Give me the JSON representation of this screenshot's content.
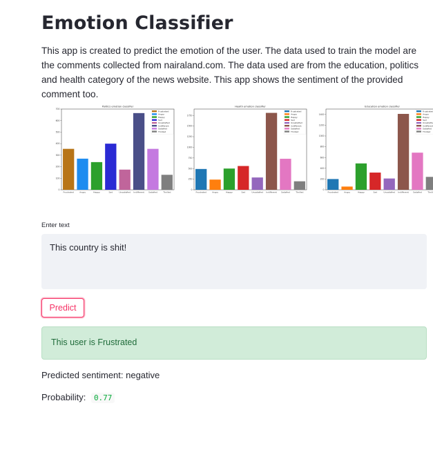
{
  "app": {
    "title": "Emotion Classifier",
    "description": "This app is created to predict the emotion of the user. The data used to train the model are the comments collected from nairaland.com. The data used are from the education, politics and health category of the news website. This app shows the sentiment of the provided comment too."
  },
  "input": {
    "label": "Enter text",
    "value": "This country is shit!"
  },
  "predict_button": {
    "label": "Predict"
  },
  "result": {
    "alert_text": "This user is Frustrated",
    "sentiment_text": "Predicted sentiment: negative",
    "probability_label": "Probability:",
    "probability_value": "0.77"
  },
  "chart_data": [
    {
      "type": "bar",
      "title": "Politics emotion classifier",
      "categories": [
        "Frustrated",
        "Angry",
        "Happy",
        "Sad",
        "Unsatisfied",
        "Indifferent",
        "Satisfied",
        "Thrilled"
      ],
      "values": [
        355,
        270,
        240,
        400,
        175,
        665,
        355,
        130
      ],
      "ylim": [
        0,
        700
      ],
      "yticks": [
        0,
        100,
        200,
        300,
        400,
        500,
        600,
        700
      ],
      "colors": [
        "#b87518",
        "#1e8cf0",
        "#2ca02c",
        "#2a2ad4",
        "#c0659b",
        "#4a4f88",
        "#c479e0",
        "#7f7f7f"
      ],
      "legend": [
        "Frustrated",
        "Angry",
        "Happy",
        "Sad",
        "Unsatisfied",
        "Indifferent",
        "Satisfied",
        "Thrilled"
      ],
      "legend_colors": [
        "#b87518",
        "#1e8cf0",
        "#2ca02c",
        "#2a2ad4",
        "#c0659b",
        "#4a4f88",
        "#c479e0",
        "#7f7f7f"
      ],
      "legend_position": "top-right"
    },
    {
      "type": "bar",
      "title": "Health emotion classifier",
      "categories": [
        "Frustrated",
        "Angry",
        "Happy",
        "Sad",
        "Unsatisfied",
        "Indifferent",
        "Satisfied",
        "Thrilled"
      ],
      "values": [
        490,
        240,
        500,
        560,
        290,
        1810,
        730,
        200
      ],
      "ylim": [
        0,
        1900
      ],
      "yticks": [
        0,
        250,
        500,
        750,
        1000,
        1250,
        1500,
        1750
      ],
      "colors": [
        "#1f77b4",
        "#ff7f0e",
        "#2ca02c",
        "#d62728",
        "#9467bd",
        "#8c564b",
        "#e377c2",
        "#7f7f7f"
      ],
      "legend": [
        "Frustrated",
        "Angry",
        "Happy",
        "Sad",
        "Unsatisfied",
        "Indifferent",
        "Satisfied",
        "Thrilled"
      ],
      "legend_colors": [
        "#1f77b4",
        "#ff7f0e",
        "#2ca02c",
        "#d62728",
        "#9467bd",
        "#8c564b",
        "#e377c2",
        "#7f7f7f"
      ],
      "legend_position": "top-right"
    },
    {
      "type": "bar",
      "title": "Education emotion classifier",
      "categories": [
        "Frustrated",
        "Angry",
        "Happy",
        "Sad",
        "Unsatisfied",
        "Indifferent",
        "Satisfied",
        "Thrilled"
      ],
      "values": [
        200,
        60,
        490,
        320,
        210,
        1410,
        690,
        240
      ],
      "ylim": [
        0,
        1500
      ],
      "yticks": [
        0,
        200,
        400,
        600,
        800,
        1000,
        1200,
        1400
      ],
      "colors": [
        "#1f77b4",
        "#ff7f0e",
        "#2ca02c",
        "#d62728",
        "#9467bd",
        "#8c564b",
        "#e377c2",
        "#7f7f7f"
      ],
      "legend": [
        "Frustrated",
        "Angry",
        "Happy",
        "Sad",
        "Unsatisfied",
        "Indifferent",
        "Satisfied",
        "Thrilled"
      ],
      "legend_colors": [
        "#1f77b4",
        "#ff7f0e",
        "#2ca02c",
        "#d62728",
        "#9467bd",
        "#8c564b",
        "#e377c2",
        "#7f7f7f"
      ],
      "legend_position": "top-right"
    }
  ]
}
